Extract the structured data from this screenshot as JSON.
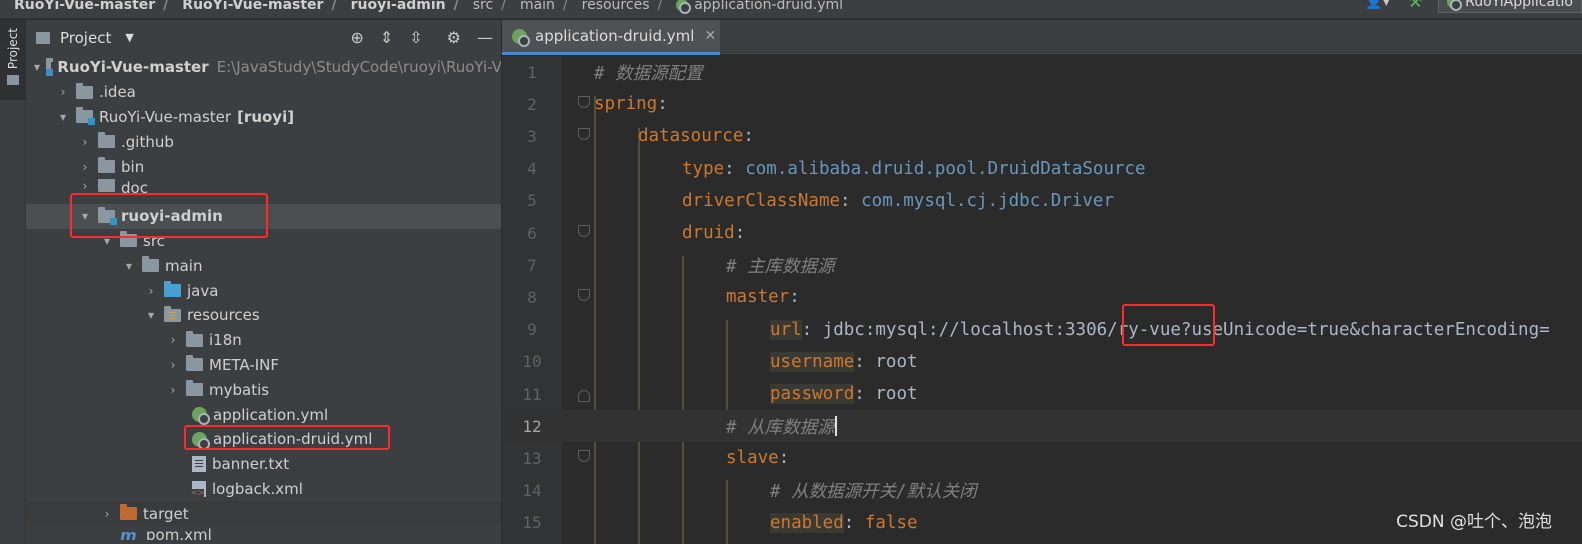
{
  "breadcrumb": {
    "items": [
      "RuoYi-Vue-master",
      "RuoYi-Vue-master",
      "ruoyi-admin",
      "src",
      "main",
      "resources",
      "application-druid.yml"
    ],
    "run_config_label": "RuoYiApplicatio"
  },
  "stripe": {
    "project_tab_label": "Project"
  },
  "project_panel": {
    "title": "Project",
    "tree": [
      {
        "label": "RuoYi-Vue-master",
        "suffix": "E:\\JavaStudy\\StudyCode\\ruoyi\\RuoYi-V"
      },
      {
        "label": ".idea"
      },
      {
        "label": "RuoYi-Vue-master",
        "suffix": "[ruoyi]"
      },
      {
        "label": ".github"
      },
      {
        "label": "bin"
      },
      {
        "label": "doc"
      },
      {
        "label": "ruoyi-admin"
      },
      {
        "label": "src"
      },
      {
        "label": "main"
      },
      {
        "label": "java"
      },
      {
        "label": "resources"
      },
      {
        "label": "i18n"
      },
      {
        "label": "META-INF"
      },
      {
        "label": "mybatis"
      },
      {
        "label": "application.yml"
      },
      {
        "label": "application-druid.yml"
      },
      {
        "label": "banner.txt"
      },
      {
        "label": "logback.xml"
      },
      {
        "label": "target"
      },
      {
        "label": "pom.xml"
      }
    ]
  },
  "editor": {
    "tab_label": "application-druid.yml",
    "lines": [
      {
        "n": "1",
        "comment": "# 数据源配置"
      },
      {
        "n": "2",
        "key": "spring",
        "sep": ":"
      },
      {
        "n": "3",
        "key": "datasource",
        "sep": ":"
      },
      {
        "n": "4",
        "key": "type",
        "sep": ": ",
        "value": "com.alibaba.druid.pool.DruidDataSource"
      },
      {
        "n": "5",
        "key": "driverClassName",
        "sep": ": ",
        "value": "com.mysql.cj.jdbc.Driver"
      },
      {
        "n": "6",
        "key": "druid",
        "sep": ":"
      },
      {
        "n": "7",
        "comment": "# 主库数据源"
      },
      {
        "n": "8",
        "key": "master",
        "sep": ":"
      },
      {
        "n": "9",
        "key": "url",
        "sep": ": ",
        "value": "jdbc:mysql://localhost:3306/ry-vue?useUnicode=true&characterEncoding="
      },
      {
        "n": "10",
        "key": "username",
        "sep": ": ",
        "value": "root"
      },
      {
        "n": "11",
        "key": "password",
        "sep": ": ",
        "value": "root"
      },
      {
        "n": "12",
        "comment": "# 从库数据源"
      },
      {
        "n": "13",
        "key": "slave",
        "sep": ":"
      },
      {
        "n": "14",
        "comment": "# 从数据源开关/默认关闭"
      },
      {
        "n": "15",
        "key": "enabled",
        "sep": ": ",
        "value": "false"
      }
    ]
  },
  "watermark": "CSDN @吐个、泡泡",
  "colors": {
    "highlight_box": "#ff2a2a",
    "accent": "#4a88c7"
  }
}
